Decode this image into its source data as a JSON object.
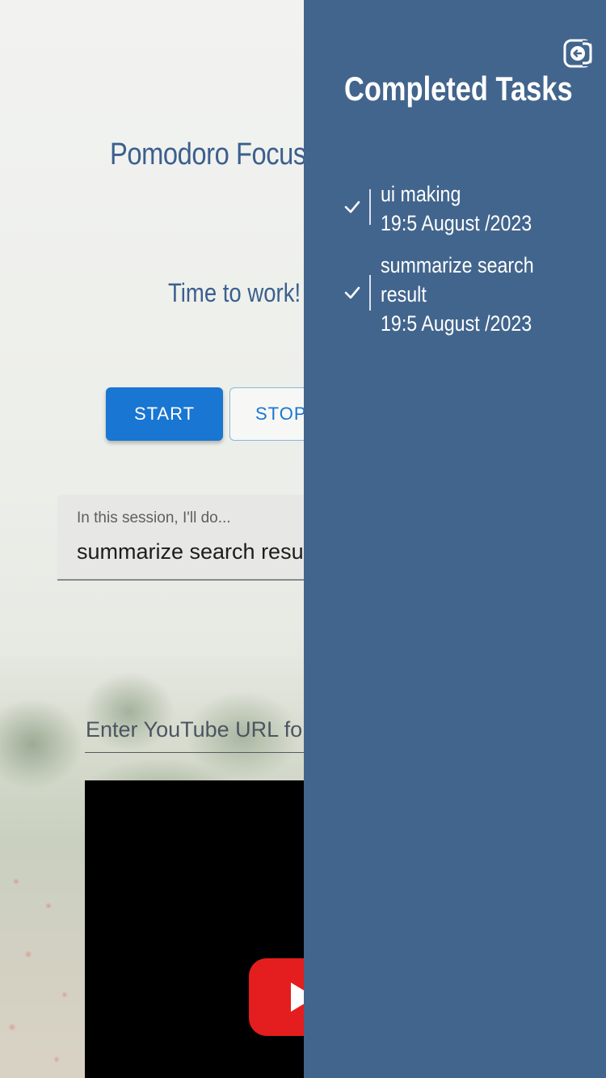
{
  "app": {
    "title": "Pomodoro Focus",
    "status": "Time to work!"
  },
  "controls": {
    "start_label": "START",
    "stop_label": "STOP"
  },
  "task_field": {
    "label": "In this session, I'll do...",
    "value": "summarize search result"
  },
  "bgm": {
    "placeholder": "Enter YouTube URL for BGM"
  },
  "panel": {
    "title": "Completed Tasks",
    "close_icon": "exit-arrow-icon",
    "tasks": [
      {
        "name_lines": [
          "ui making"
        ],
        "timestamp": "19:5 August /2023"
      },
      {
        "name_lines": [
          "summarize search",
          "result"
        ],
        "timestamp": "19:5 August /2023"
      }
    ]
  },
  "colors": {
    "panel_bg": "#42658d",
    "primary": "#1976d2",
    "title_text": "#3c5f8e",
    "youtube_red": "#e41e1e"
  }
}
